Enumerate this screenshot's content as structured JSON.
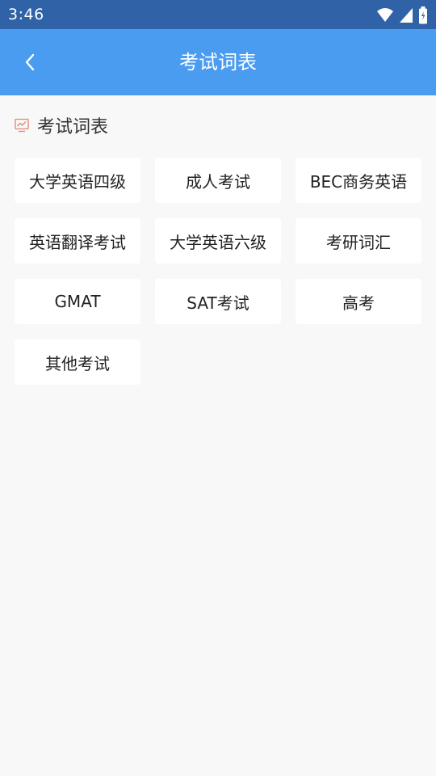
{
  "status_bar": {
    "time": "3:46",
    "icons": [
      "wifi-icon",
      "cell-signal-icon",
      "battery-icon"
    ]
  },
  "app_bar": {
    "title": "考试词表",
    "back_icon": "chevron-left-icon"
  },
  "section": {
    "icon": "chart-icon",
    "title": "考试词表"
  },
  "exams": [
    "大学英语四级",
    "成人考试",
    "BEC商务英语",
    "英语翻译考试",
    "大学英语六级",
    "考研词汇",
    "GMAT",
    "SAT考试",
    "高考",
    "其他考试"
  ],
  "colors": {
    "status_bar": "#2f62a6",
    "app_bar": "#4a9cf0",
    "background": "#f8f8f8",
    "section_icon": "#e8826e"
  }
}
